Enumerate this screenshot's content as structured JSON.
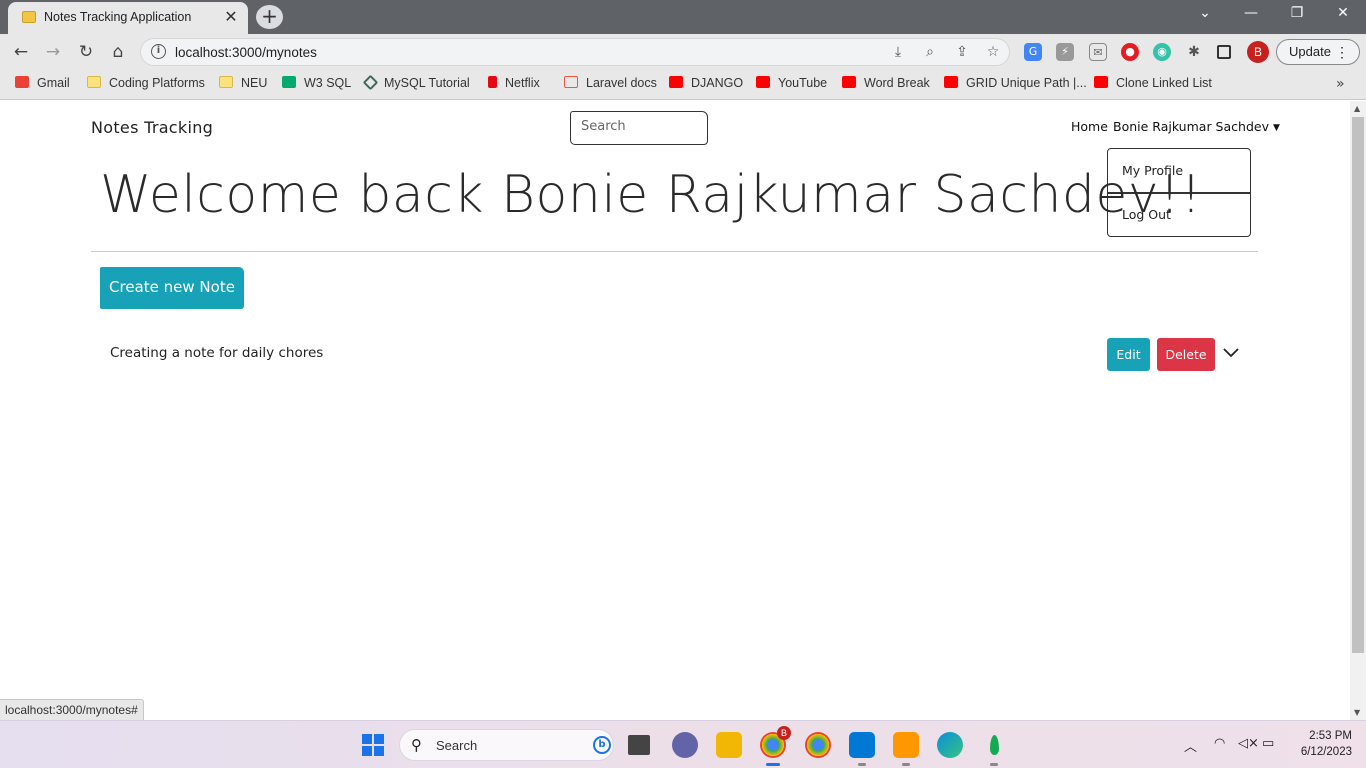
{
  "browser": {
    "tab_title": "Notes Tracking Application",
    "tab_close": "✕",
    "new_tab": "+",
    "url": "localhost:3000/mynotes",
    "update_label": "Update",
    "avatar_letter": "B",
    "status_url": "localhost:3000/mynotes#"
  },
  "bookmarks": [
    {
      "label": "Gmail",
      "icon": "gmail-icon"
    },
    {
      "label": "Coding Platforms",
      "icon": "folder-icon"
    },
    {
      "label": "NEU",
      "icon": "folder-icon"
    },
    {
      "label": "W3 SQL",
      "icon": "w3schools-icon"
    },
    {
      "label": "MySQL Tutorial",
      "icon": "mysql-icon"
    },
    {
      "label": "Netflix",
      "icon": "netflix-icon"
    },
    {
      "label": "Laravel docs",
      "icon": "laravel-icon"
    },
    {
      "label": "DJANGO",
      "icon": "youtube-icon"
    },
    {
      "label": "YouTube",
      "icon": "youtube-icon"
    },
    {
      "label": "Word Break",
      "icon": "youtube-icon"
    },
    {
      "label": "GRID Unique Path |...",
      "icon": "youtube-icon"
    },
    {
      "label": "Clone Linked List",
      "icon": "youtube-icon"
    }
  ],
  "app": {
    "brand": "Notes Tracking",
    "search_placeholder": "Search",
    "nav_home": "Home",
    "nav_user": "Bonie Rajkumar Sachdev",
    "dropdown": {
      "profile": "My Profile",
      "logout": "Log Out"
    },
    "welcome": "Welcome back Bonie Rajkumar Sachdev!!",
    "create_button": "Create new Note",
    "notes": [
      {
        "title": "Creating a note for daily chores",
        "edit": "Edit",
        "delete": "Delete"
      }
    ]
  },
  "taskbar": {
    "search_label": "Search",
    "time": "2:53 PM",
    "date": "6/12/2023",
    "chrome_badge": "B"
  },
  "colors": {
    "primary": "#17a2b8",
    "danger": "#dc3545",
    "titlebar": "#5f6368"
  }
}
